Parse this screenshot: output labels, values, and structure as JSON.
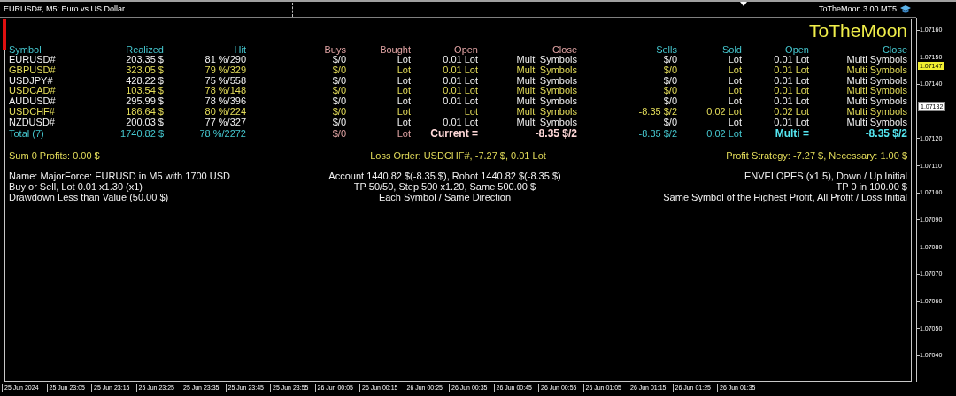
{
  "window": {
    "title": "EURUSD#, M5:  Euro vs US Dollar",
    "expert": "ToTheMoon 3.00 MT5"
  },
  "panel": {
    "title": "ToTheMoon",
    "columns": [
      {
        "label": "Symbol",
        "kind": "summary"
      },
      {
        "label": "Realized",
        "kind": "summary"
      },
      {
        "label": "Hit",
        "kind": "summary"
      },
      {
        "label": "Buys",
        "kind": "buy"
      },
      {
        "label": "Bought",
        "kind": "buy"
      },
      {
        "label": "Open",
        "kind": "buy"
      },
      {
        "label": "Close",
        "kind": "buy"
      },
      {
        "label": "Sells",
        "kind": "sell"
      },
      {
        "label": "Sold",
        "kind": "sell"
      },
      {
        "label": "Open",
        "kind": "sell"
      },
      {
        "label": "Close",
        "kind": "sell"
      }
    ],
    "rows": [
      {
        "highlighted": false,
        "cells": [
          "EURUSD#",
          "203.35 $",
          "81 %/290",
          "$/0",
          "Lot",
          "0.01 Lot",
          "Multi Symbols",
          "$/0",
          "Lot",
          "0.01 Lot",
          "Multi Symbols"
        ]
      },
      {
        "highlighted": true,
        "cells": [
          "GBPUSD#",
          "323.05 $",
          "79 %/329",
          "$/0",
          "Lot",
          "0.01 Lot",
          "Multi Symbols",
          "$/0",
          "Lot",
          "0.01 Lot",
          "Multi Symbols"
        ]
      },
      {
        "highlighted": false,
        "cells": [
          "USDJPY#",
          "428.22 $",
          "75 %/558",
          "$/0",
          "Lot",
          "0.01 Lot",
          "Multi Symbols",
          "$/0",
          "Lot",
          "0.01 Lot",
          "Multi Symbols"
        ]
      },
      {
        "highlighted": true,
        "cells": [
          "USDCAD#",
          "103.54 $",
          "78 %/148",
          "$/0",
          "Lot",
          "0.01 Lot",
          "Multi Symbols",
          "$/0",
          "Lot",
          "0.01 Lot",
          "Multi Symbols"
        ]
      },
      {
        "highlighted": false,
        "cells": [
          "AUDUSD#",
          "295.99 $",
          "78 %/396",
          "$/0",
          "Lot",
          "0.01 Lot",
          "Multi Symbols",
          "$/0",
          "Lot",
          "0.01 Lot",
          "Multi Symbols"
        ]
      },
      {
        "highlighted": true,
        "cells": [
          "USDCHF#",
          "186.64 $",
          "80 %/224",
          "$/0",
          "Lot",
          "Lot",
          "Multi Symbols",
          "-8.35 $/2",
          "0.02 Lot",
          "0.02 Lot",
          "Multi Symbols"
        ]
      },
      {
        "highlighted": false,
        "cells": [
          "NZDUSD#",
          "200.03 $",
          "77 %/327",
          "$/0",
          "Lot",
          "0.01 Lot",
          "Multi Symbols",
          "$/0",
          "Lot",
          "0.01 Lot",
          "Multi Symbols"
        ]
      }
    ],
    "total": [
      {
        "text": "Total (7)",
        "kind": "summary"
      },
      {
        "text": "1740.82 $",
        "kind": "summary"
      },
      {
        "text": "78 %/2272",
        "kind": "summary"
      },
      {
        "text": "$/0",
        "kind": "buy"
      },
      {
        "text": "Lot",
        "kind": "buy"
      },
      {
        "text": "Current =",
        "kind": "buystrong"
      },
      {
        "text": "-8.35 $/2",
        "kind": "buystrong"
      },
      {
        "text": "-8.35 $/2",
        "kind": "sell"
      },
      {
        "text": "0.02 Lot",
        "kind": "sell"
      },
      {
        "text": "Multi =",
        "kind": "sellstrong"
      },
      {
        "text": "-8.35 $/2",
        "kind": "sellstrong"
      }
    ],
    "status": {
      "left": "Sum 0 Profits: 0.00 $",
      "center": "Loss Order: USDCHF#, -7.27 $, 0.01 Lot",
      "right": "Profit Strategy: -7.27 $, Necessary: 1.00 $"
    },
    "info_lines": [
      {
        "left": "Name: MajorForce: EURUSD in M5 with 1700 USD",
        "center": "Account 1440.82 $(-8.35 $), Robot 1440.82 $(-8.35 $)",
        "right": "ENVELOPES (x1.5), Down / Up Initial"
      },
      {
        "left": "Buy or Sell, Lot 0.01 x1.30 (x1)",
        "center": "TP 50/50, Step 500 x1.20, Same 500.00 $",
        "right": "TP 0 in 100.00 $"
      },
      {
        "left": "Drawdown Less than Value (50.00 $)",
        "center": "Each Symbol / Same Direction",
        "right": "Same Symbol of the Highest Profit, All Profit / Loss Initial"
      }
    ]
  },
  "price_axis": {
    "ticks": [
      "1.07160",
      "1.07150",
      "1.07140",
      "1.07120",
      "1.07110",
      "1.07100",
      "1.07090",
      "1.07080",
      "1.07070",
      "1.07060",
      "1.07050",
      "1.07040"
    ],
    "markers": [
      {
        "label": "1.07147",
        "kind": "bid"
      },
      {
        "label": "1.07132",
        "kind": "last"
      }
    ]
  },
  "time_axis": [
    "25 Jun 2024",
    "25 Jun 23:05",
    "25 Jun 23:15",
    "25 Jun 23:25",
    "25 Jun 23:35",
    "25 Jun 23:45",
    "25 Jun 23:55",
    "26 Jun 00:05",
    "26 Jun 00:15",
    "26 Jun 00:25",
    "26 Jun 00:35",
    "26 Jun 00:45",
    "26 Jun 00:55",
    "26 Jun 01:05",
    "26 Jun 01:15",
    "26 Jun 01:25",
    "26 Jun 01:35"
  ]
}
